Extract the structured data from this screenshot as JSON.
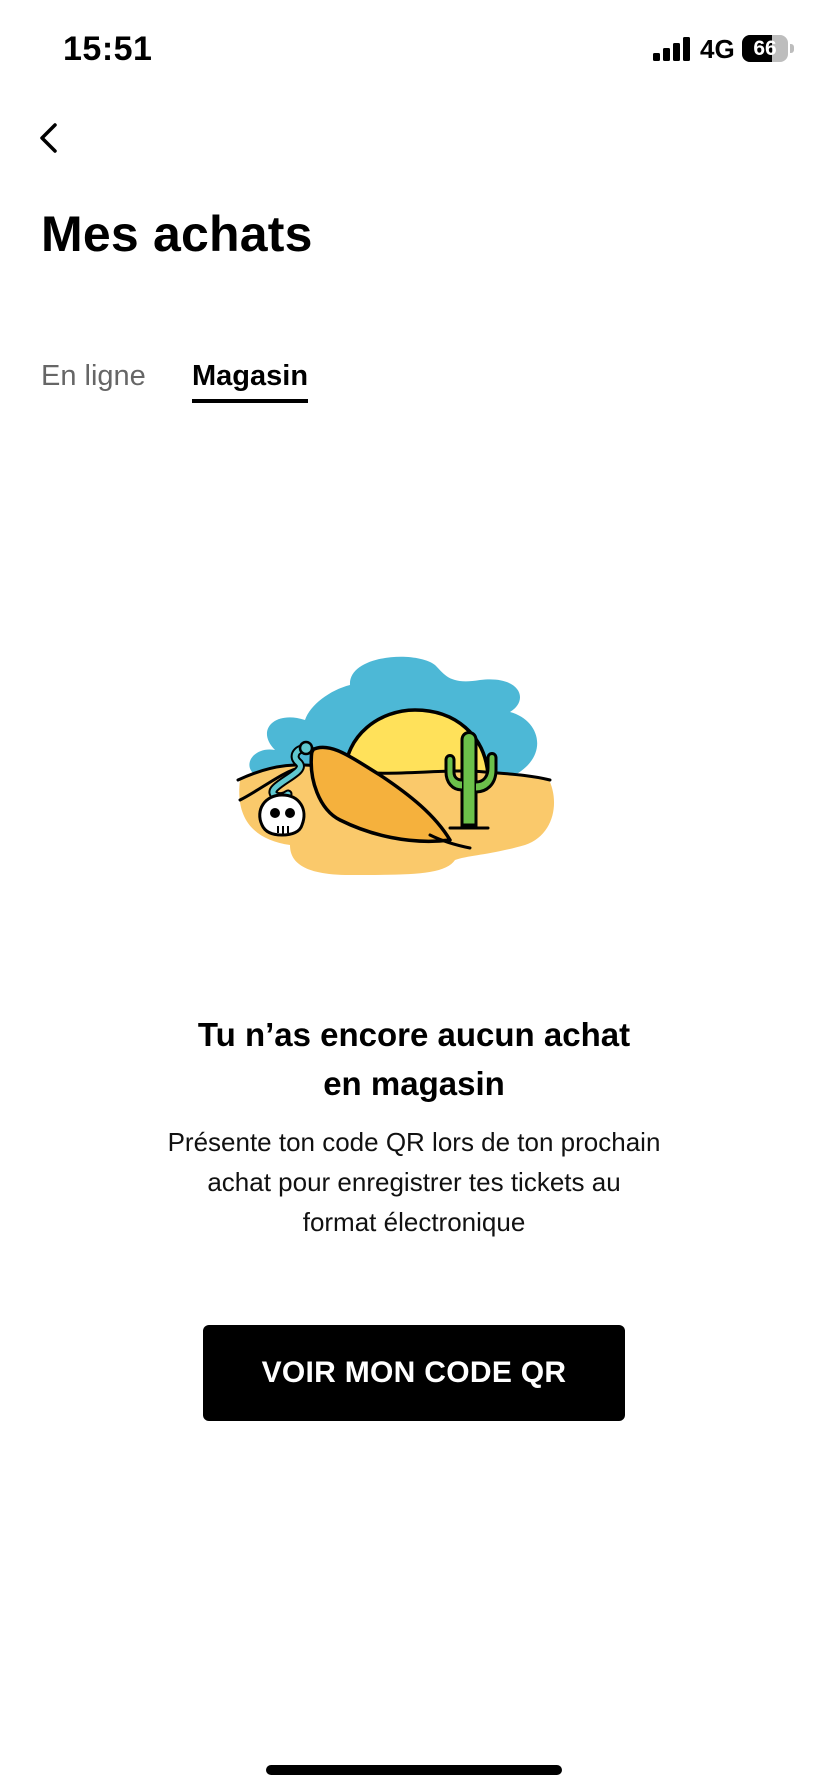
{
  "status_bar": {
    "time": "15:51",
    "network": "4G",
    "battery": "66",
    "battery_level": 0.66
  },
  "header": {
    "title": "Mes achats"
  },
  "tabs": [
    {
      "label": "En ligne",
      "active": false
    },
    {
      "label": "Magasin",
      "active": true
    }
  ],
  "empty_state": {
    "title_line1": "Tu n’as encore aucun achat",
    "title_line2": "en magasin",
    "desc_line1": "Présente ton code QR lors de ton prochain",
    "desc_line2": "achat pour enregistrer tes tickets au",
    "desc_line3": "format électronique",
    "illustration": "desert-illustration"
  },
  "actions": {
    "qr_button": "VOIR MON CODE QR"
  },
  "colors": {
    "sky": "#4DB8D6",
    "sun": "#FFE15A",
    "sand": "#FAC96B",
    "dune": "#F5B13D",
    "cactus": "#6CC04A",
    "button_bg": "#000000",
    "button_text": "#FFFFFF"
  }
}
